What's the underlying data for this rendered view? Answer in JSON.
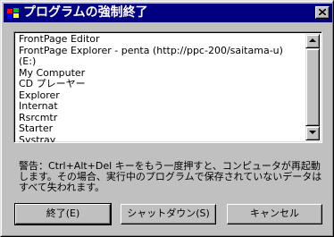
{
  "window": {
    "title": "プログラムの強制終了"
  },
  "process_list": {
    "items": [
      "FrontPage Editor",
      "FrontPage Explorer - penta (http://ppc-200/saitama-u)",
      "(E:)",
      "My Computer",
      "CD プレーヤー",
      "Explorer",
      "Internat",
      "Rsrcmtr",
      "Starter",
      "Systray"
    ]
  },
  "warning": {
    "text": "警告：Ctrl+Alt+Del キーをもう一度押すと、コンピュータが再起動します。その場合、実行中のプログラムで保存されていないデータはすべて失われます。"
  },
  "buttons": {
    "end_task": "終了(E)",
    "shutdown": "シャットダウン(S)",
    "cancel": "キャンセル"
  },
  "icons": {
    "app": "windows-flag-icon",
    "close": "close-icon",
    "scroll_up": "arrow-up-icon",
    "scroll_down": "arrow-down-icon"
  },
  "colors": {
    "titlebar": "#000080",
    "face": "#c0c0c0"
  }
}
